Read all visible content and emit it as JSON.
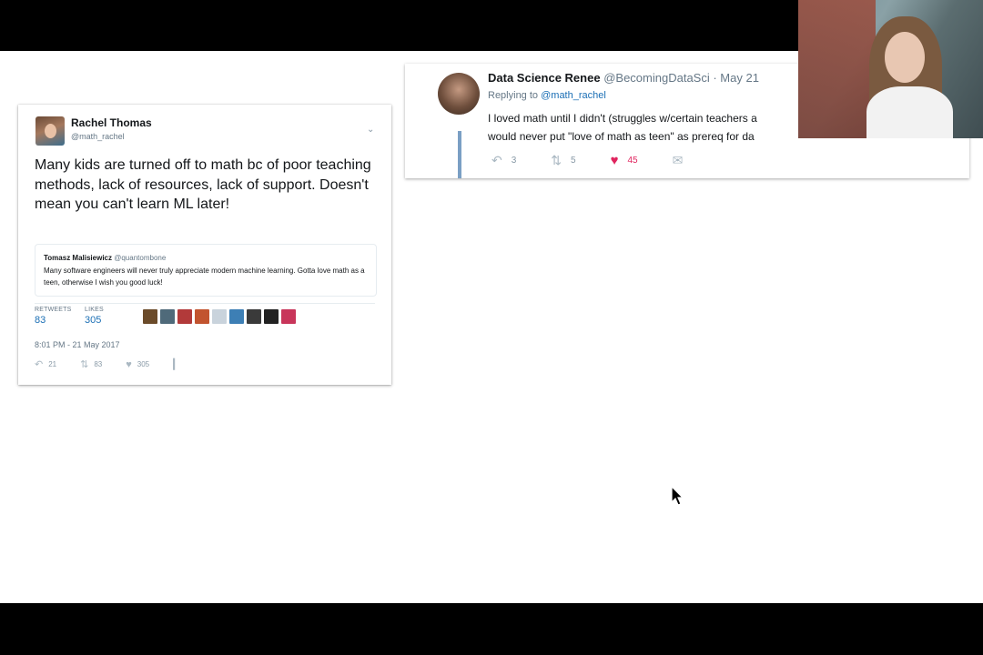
{
  "tweet1": {
    "name": "Rachel Thomas",
    "handle": "@math_rachel",
    "text": "Many kids are turned off to math bc of poor teaching methods, lack of resources, lack of support. Doesn't mean you can't learn ML later!",
    "quoted": {
      "name": "Tomasz Malisiewicz",
      "handle": "@quantombone",
      "text": "Many software engineers will never truly appreciate modern machine learning. Gotta love math as a teen, otherwise I wish you good luck!"
    },
    "stats": {
      "retweets_label": "RETWEETS",
      "retweets": "83",
      "likes_label": "LIKES",
      "likes": "305"
    },
    "timestamp": "8:01 PM - 21 May 2017",
    "actions": {
      "reply": "21",
      "retweet": "83",
      "like": "305"
    }
  },
  "tweet2": {
    "name": "Data Science Renee",
    "handle": "@BecomingDataSci",
    "date": "· May 21",
    "replying_prefix": "Replying to",
    "replying_to": "@math_rachel",
    "line1": "I loved math until I didn't (struggles w/certain teachers a",
    "line2": "would never put \"love of math as teen\" as prereq for da",
    "actions": {
      "reply": "3",
      "retweet": "5",
      "like": "45"
    }
  },
  "icons": {
    "reply": "reply-icon",
    "retweet": "retweet-icon",
    "like": "heart-icon",
    "analytics": "analytics-icon",
    "message": "envelope-icon",
    "menu": "chevron-down-icon"
  },
  "colors": {
    "link": "#1b6fb5",
    "like_active": "#e0245e",
    "thread_line": "#7a9fc4"
  }
}
